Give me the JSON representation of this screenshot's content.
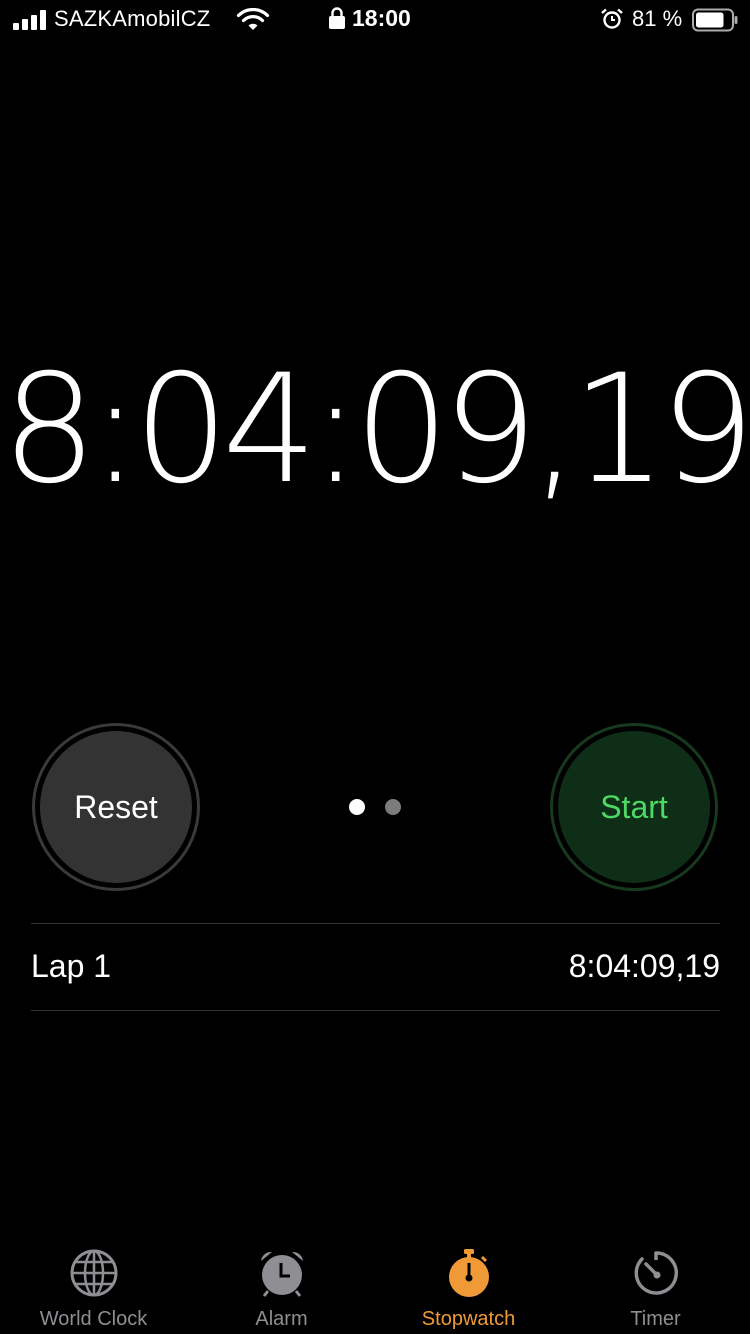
{
  "status_bar": {
    "carrier": "SAZKAmobilCZ",
    "time": "18:00",
    "battery_percent": "81 %",
    "battery_level": 0.81,
    "signal_bars": 4,
    "icons": [
      "signal-icon",
      "wifi-icon",
      "lock-icon",
      "alarm-icon",
      "battery-icon"
    ]
  },
  "stopwatch": {
    "elapsed": "8:04:09,19"
  },
  "controls": {
    "reset_label": "Reset",
    "start_label": "Start",
    "page_count": 2,
    "active_page": 1
  },
  "laps": [
    {
      "label": "Lap 1",
      "time": "8:04:09,19"
    }
  ],
  "tabs": [
    {
      "label": "World Clock",
      "icon": "globe-icon",
      "active": false
    },
    {
      "label": "Alarm",
      "icon": "alarm-clock-icon",
      "active": false
    },
    {
      "label": "Stopwatch",
      "icon": "stopwatch-icon",
      "active": true
    },
    {
      "label": "Timer",
      "icon": "timer-icon",
      "active": false
    }
  ],
  "colors": {
    "background": "#000000",
    "accent": "#f09a37",
    "start_green": "#4cd964",
    "inactive_tab": "#8e8e93"
  }
}
